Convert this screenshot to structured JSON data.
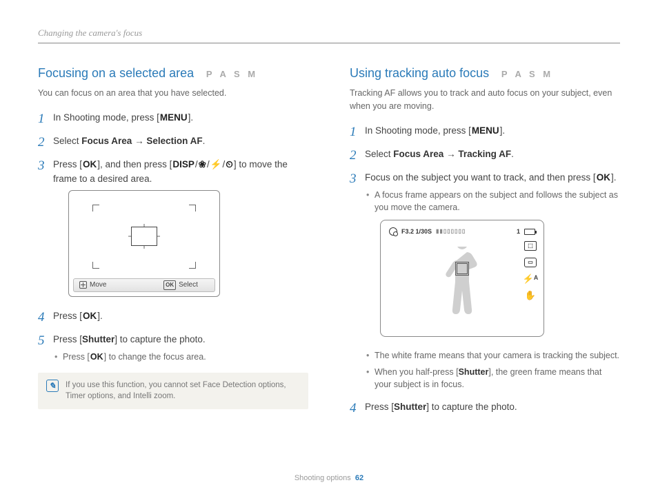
{
  "header": "Changing the camera's focus",
  "mode_tags": "P A S M",
  "left": {
    "title": "Focusing on a selected area",
    "intro": "You can focus on an area that you have selected.",
    "step1_a": "In Shooting mode, press [",
    "step1_b": "].",
    "menu": "MENU",
    "step2_a": "Select ",
    "step2_b": "Focus Area",
    "step2_c": " → ",
    "step2_d": "Selection AF",
    "step2_e": ".",
    "step3_a": "Press [",
    "ok": "OK",
    "step3_b": "], and then press [",
    "disp": "DISP",
    "step3_c": "/",
    "step3_d": "/",
    "step3_e": "/",
    "step3_f": "] to move the frame to a desired area.",
    "move": "Move",
    "select": "Select",
    "step4_a": "Press [",
    "step4_b": "].",
    "step5_a": "Press [",
    "shutter": "Shutter",
    "step5_b": "] to capture the photo.",
    "step5_bul_a": "Press [",
    "step5_bul_b": "] to change the focus area.",
    "note": "If you use this function, you cannot set Face Detection options, Timer options, and Intelli zoom."
  },
  "right": {
    "title": "Using tracking auto focus",
    "intro": "Tracking AF allows you to track and auto focus on your subject, even when you are moving.",
    "step1_a": "In Shooting mode, press [",
    "step1_b": "].",
    "step2_a": "Select ",
    "step2_b": "Focus Area",
    "step2_c": " → ",
    "step2_d": "Tracking AF",
    "step2_e": ".",
    "step3_a": "Focus on the subject you want to track, and then press [",
    "step3_b": "].",
    "step3_bul": "A focus frame appears on the subject and follows the subject as you move the camera.",
    "screen_info": "F3.2  1/30S",
    "screen_one": "1",
    "bul1": "The white frame means that your camera is tracking the subject.",
    "bul2_a": "When you half-press [",
    "bul2_b": "], the green frame means that your subject is in focus.",
    "step4_a": "Press [",
    "step4_b": "] to capture the photo."
  },
  "footer": {
    "section": "Shooting options",
    "page": "62"
  }
}
